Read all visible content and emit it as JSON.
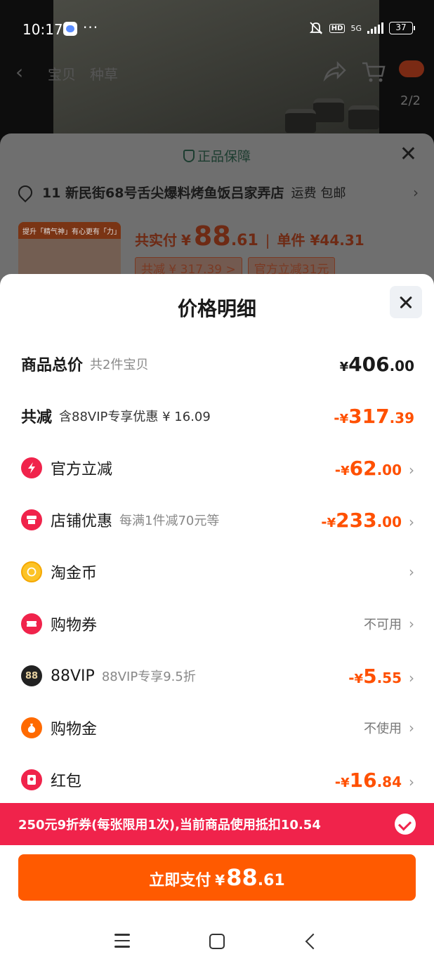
{
  "status_bar": {
    "time": "10:17",
    "dots": "···",
    "hd": "HD",
    "network": "5G",
    "battery": "37"
  },
  "product_nav": {
    "tabs": [
      "宝贝",
      "种草"
    ],
    "pager": "2/2"
  },
  "order_sheet": {
    "guarantee": "正品保障",
    "address": "11 新民街68号舌尖爆料烤鱼饭吕家弄店",
    "shipping_label": "运费",
    "shipping_value": "包邮",
    "image_caption": "提升「精气神」有心更有「力」",
    "price_label": "共实付",
    "price_yen": "¥",
    "price_int": "88",
    "price_dec": ".61",
    "separator": "|",
    "unit_price": "单件 ¥44.31",
    "tags": [
      "共减 ¥ 317.39 >",
      "官方立减31元"
    ]
  },
  "price_detail": {
    "title": "价格明细",
    "rows": [
      {
        "label": "商品总价",
        "sub": "共2件宝贝",
        "minus": "",
        "yen": "¥",
        "int": "406",
        "dec": ".00"
      },
      {
        "label": "共减",
        "sub": "含88VIP专享优惠 ¥ 16.09",
        "minus": "-",
        "yen": "¥",
        "int": "317",
        "dec": ".39"
      },
      {
        "label": "官方立减",
        "sub": "",
        "minus": "-",
        "yen": "¥",
        "int": "62",
        "dec": ".00",
        "icon": "bolt-icon"
      },
      {
        "label": "店铺优惠",
        "sub": "每满1件减70元等",
        "minus": "-",
        "yen": "¥",
        "int": "233",
        "dec": ".00",
        "icon": "store-icon"
      },
      {
        "label": "淘金币",
        "sub": "",
        "icon": "coin-icon"
      },
      {
        "label": "购物券",
        "sub": "",
        "status": "不可用",
        "icon": "ticket-icon"
      },
      {
        "label": "88VIP",
        "sub": "88VIP专享9.5折",
        "minus": "-",
        "yen": "¥",
        "int": "5",
        "dec": ".55",
        "icon": "vip-icon",
        "icon_text": "88"
      },
      {
        "label": "购物金",
        "sub": "",
        "status": "不使用",
        "icon": "money-bag-icon"
      },
      {
        "label": "红包",
        "sub": "",
        "minus": "-",
        "yen": "¥",
        "int": "16",
        "dec": ".84",
        "icon": "red-packet-icon"
      }
    ]
  },
  "coupon_banner": {
    "text": "250元9折券(每张限用1次),当前商品使用抵扣10.54"
  },
  "pay_button": {
    "label": "立即支付",
    "yen": "¥",
    "int": "88",
    "dec": ".61"
  },
  "colors": {
    "accent": "#ff5000",
    "pay_button": "#ff5a00",
    "coupon_banner": "#f0234b"
  }
}
